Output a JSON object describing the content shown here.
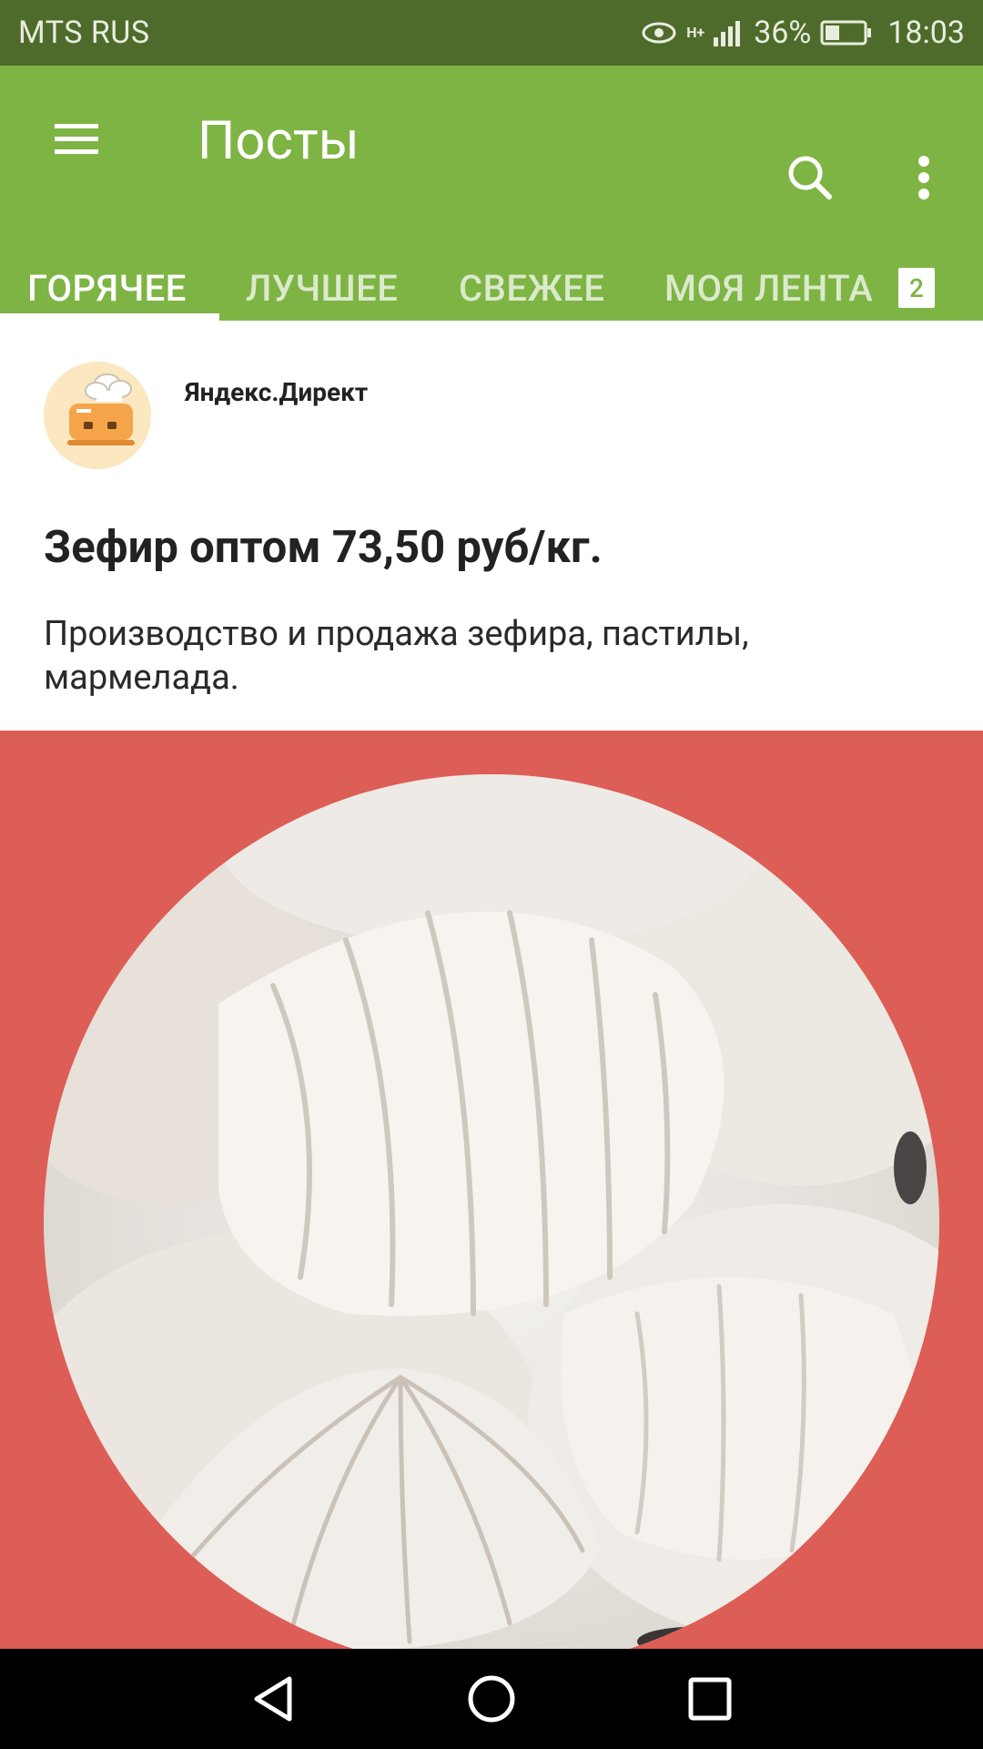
{
  "status_bar": {
    "carrier": "MTS RUS",
    "network": "H+",
    "battery": "36%",
    "time": "18:03",
    "icons": [
      "eye-icon",
      "signal-icon",
      "battery-icon"
    ]
  },
  "app_bar": {
    "title": "Посты",
    "icons": [
      "menu-icon",
      "search-icon",
      "more-vert-icon"
    ]
  },
  "tabs": [
    {
      "label": "ГОРЯЧЕЕ",
      "active": true
    },
    {
      "label": "ЛУЧШЕЕ",
      "active": false
    },
    {
      "label": "СВЕЖЕЕ",
      "active": false
    },
    {
      "label": "МОЯ ЛЕНТА",
      "active": false,
      "badge": "2"
    }
  ],
  "post": {
    "author": "Яндекс.Директ",
    "headline": "Зефир оптом 73,50 руб/кг.",
    "description": "Производство и продажа зефира, пастилы, мармелада."
  },
  "nav_bar": {
    "icons": [
      "back-icon",
      "home-icon",
      "recents-icon"
    ]
  },
  "colors": {
    "status_bar": "#4f6b2b",
    "app_bar": "#7eb444",
    "ad_background": "#dd5e56",
    "nav_bar": "#000000"
  }
}
